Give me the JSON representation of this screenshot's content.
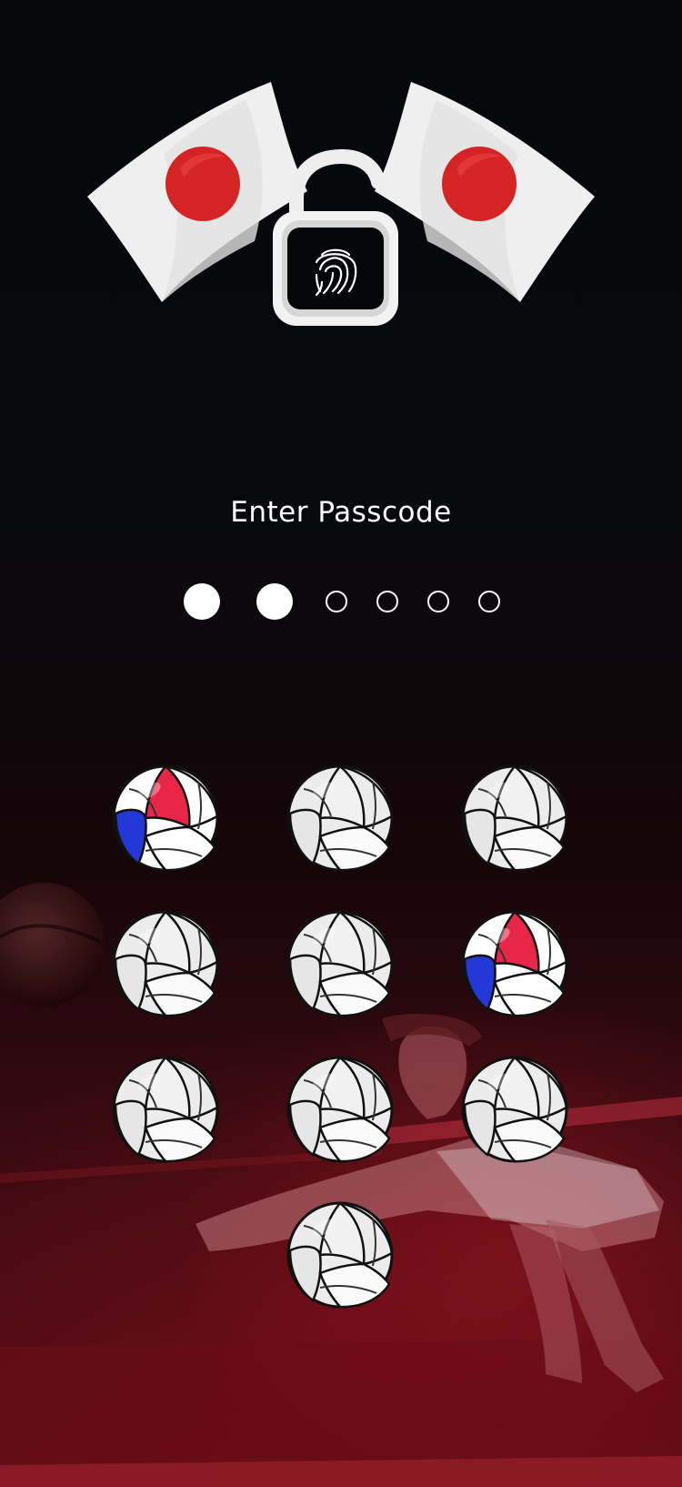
{
  "screen": {
    "title": "Enter Passcode"
  },
  "header": {
    "lock_icon": "fingerprint-padlock-icon",
    "flags": [
      "japan-flag-icon",
      "japan-flag-icon"
    ]
  },
  "passcode": {
    "length": 6,
    "entered": 2
  },
  "keypad": {
    "keys": [
      {
        "icon": "volleyball-icon",
        "style": "tricolor"
      },
      {
        "icon": "volleyball-icon",
        "style": "white"
      },
      {
        "icon": "volleyball-icon",
        "style": "white"
      },
      {
        "icon": "volleyball-icon",
        "style": "white"
      },
      {
        "icon": "volleyball-icon",
        "style": "white"
      },
      {
        "icon": "volleyball-icon",
        "style": "tricolor"
      },
      {
        "icon": "volleyball-icon",
        "style": "white"
      },
      {
        "icon": "volleyball-icon",
        "style": "white"
      },
      {
        "icon": "volleyball-icon",
        "style": "white"
      },
      {
        "icon": "volleyball-icon",
        "style": "white"
      }
    ]
  },
  "colors": {
    "flag_red": "#d42424",
    "accent_red": "#8f1220",
    "russia_white": "#ffffff",
    "russia_blue": "#2438d8",
    "russia_red": "#e8264a"
  }
}
